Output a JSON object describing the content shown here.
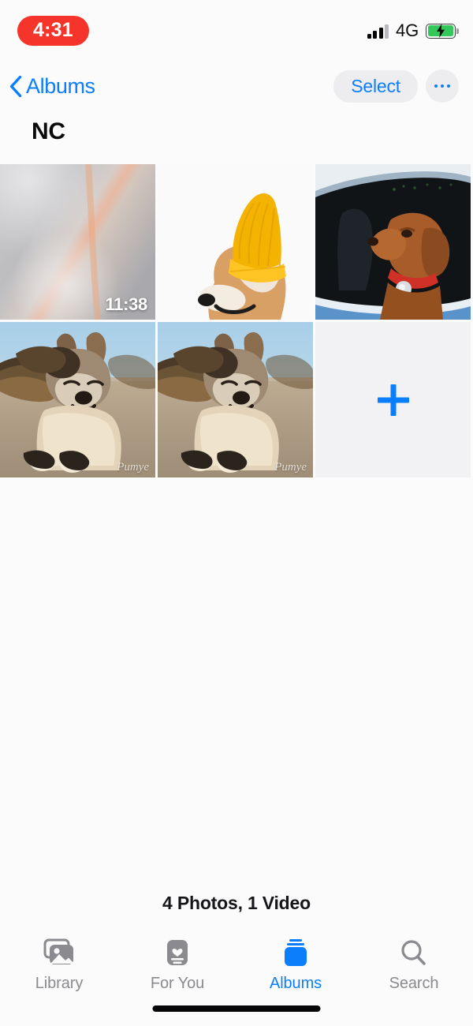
{
  "status_bar": {
    "time": "4:31",
    "time_pill_color": "#f5352b",
    "network": "4G",
    "signal_bars_filled": 3,
    "signal_bars_total": 4,
    "battery_charging": true,
    "battery_color": "#34c759"
  },
  "nav": {
    "back_label": "Albums",
    "select_label": "Select",
    "more_label": "",
    "accent_color": "#0b7ffb"
  },
  "page_title": "NC",
  "grid": {
    "items": [
      {
        "type": "video",
        "duration": "11:38",
        "alt": "blurred grey scene",
        "watermark": ""
      },
      {
        "type": "photo",
        "duration": "",
        "alt": "shiba inu wearing yellow knit hat",
        "watermark": ""
      },
      {
        "type": "photo",
        "duration": "",
        "alt": "brown dog leaning out of car window",
        "watermark": ""
      },
      {
        "type": "photo",
        "duration": "",
        "alt": "shiba inu with long flowing hair on beach",
        "watermark": "Pumye"
      },
      {
        "type": "photo",
        "duration": "",
        "alt": "shiba inu with long flowing hair on beach",
        "watermark": "Pumye"
      },
      {
        "type": "add",
        "duration": "",
        "alt": "add photos",
        "watermark": ""
      }
    ]
  },
  "footer": {
    "count_label": "4 Photos, 1 Video"
  },
  "tab_bar": {
    "tabs": [
      {
        "label": "Library",
        "icon": "photo-stack-icon",
        "active": false
      },
      {
        "label": "For You",
        "icon": "memory-card-icon",
        "active": false
      },
      {
        "label": "Albums",
        "icon": "albums-stack-icon",
        "active": true
      },
      {
        "label": "Search",
        "icon": "magnifier-icon",
        "active": false
      }
    ],
    "active_color": "#0b7ffb",
    "inactive_color": "#8a8a8f"
  }
}
